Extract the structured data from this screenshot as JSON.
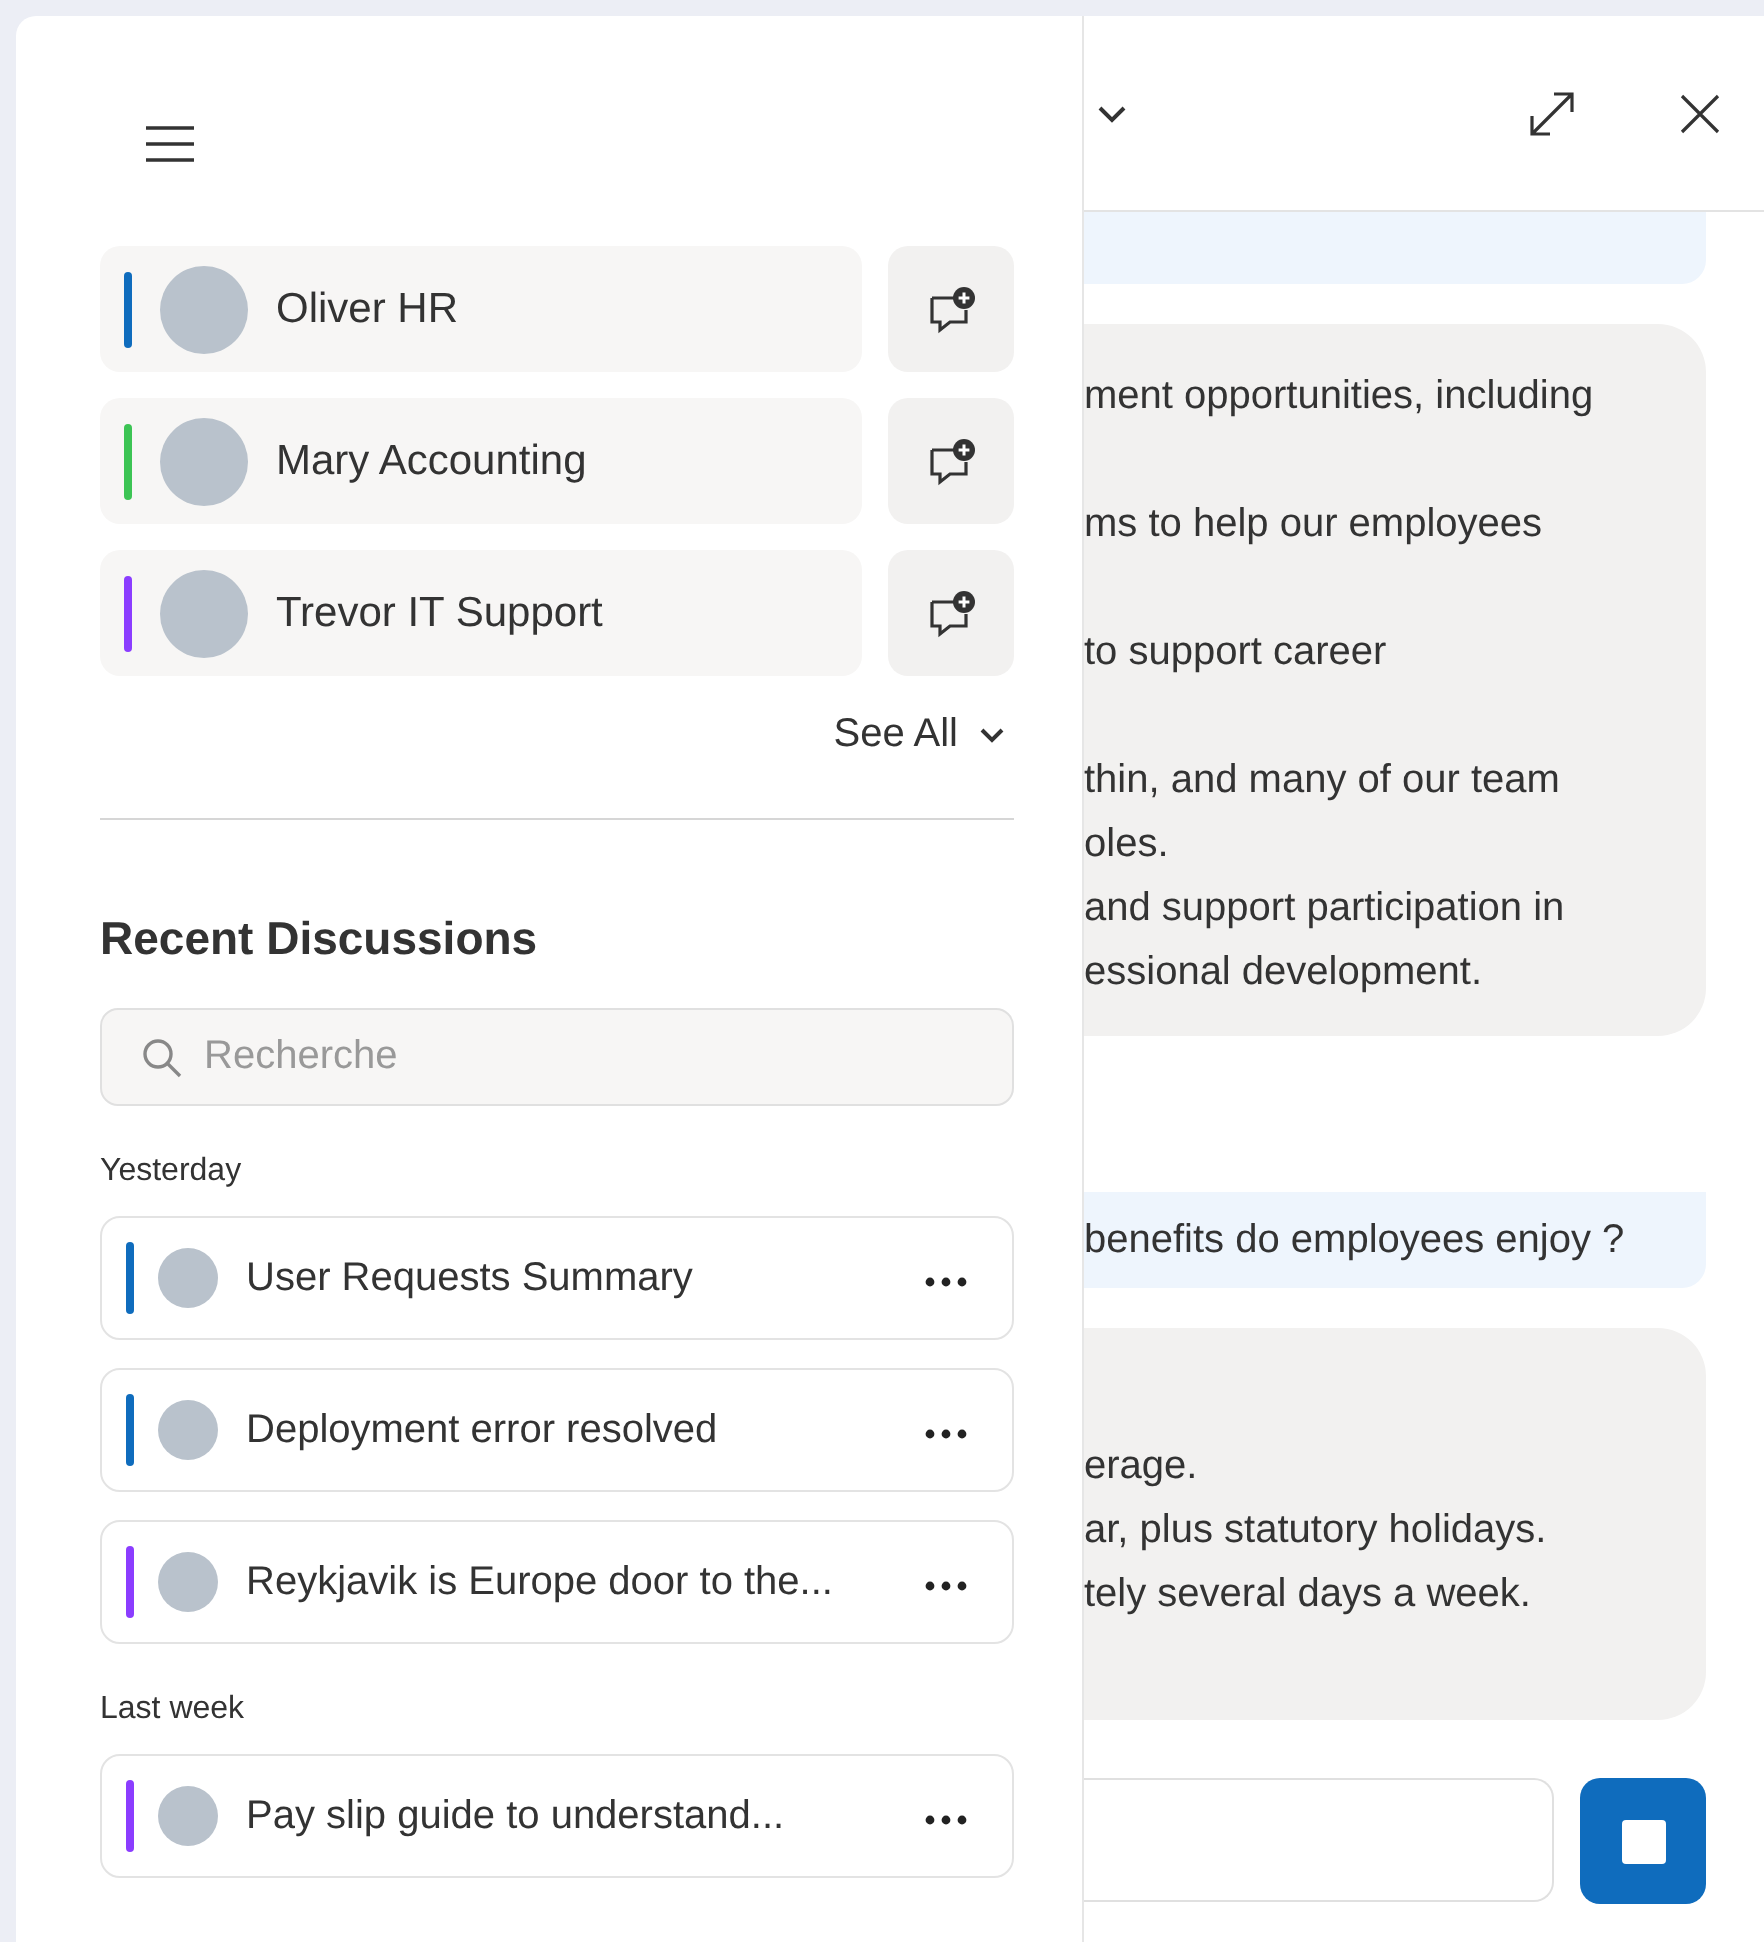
{
  "drawer": {
    "agents": [
      {
        "name": "Oliver HR",
        "color": "#0f6cbd"
      },
      {
        "name": "Mary Accounting",
        "color": "#3cc454"
      },
      {
        "name": "Trevor IT Support",
        "color": "#8b3dff"
      }
    ],
    "see_all": "See All",
    "recent_title": "Recent Discussions",
    "search": {
      "placeholder": "Recherche"
    },
    "groups": [
      {
        "label": "Yesterday",
        "items": [
          {
            "title": "User Requests Summary",
            "color": "#0f6cbd"
          },
          {
            "title": "Deployment error resolved",
            "color": "#0f6cbd"
          },
          {
            "title": "Reykjavik is Europe door to the...",
            "color": "#8b3dff"
          }
        ]
      },
      {
        "label": "Last week",
        "items": [
          {
            "title": "Pay slip guide to understand...",
            "color": "#8b3dff"
          }
        ]
      }
    ]
  },
  "chat": {
    "messages": [
      {
        "kind": "user"
      },
      {
        "kind": "assistant",
        "paragraphs": [
          [
            "ment opportunities, including"
          ],
          [
            "ms to help our employees"
          ],
          [
            "to support career"
          ],
          [
            "thin, and many of our team",
            "oles.",
            "and support participation in",
            "essional development."
          ]
        ]
      },
      {
        "kind": "user",
        "paragraphs": [
          [
            "benefits do employees enjoy ?"
          ]
        ]
      },
      {
        "kind": "assistant",
        "paragraphs": [
          [
            "erage.",
            "ar, plus statutory holidays.",
            "tely several days a week."
          ]
        ]
      }
    ]
  }
}
